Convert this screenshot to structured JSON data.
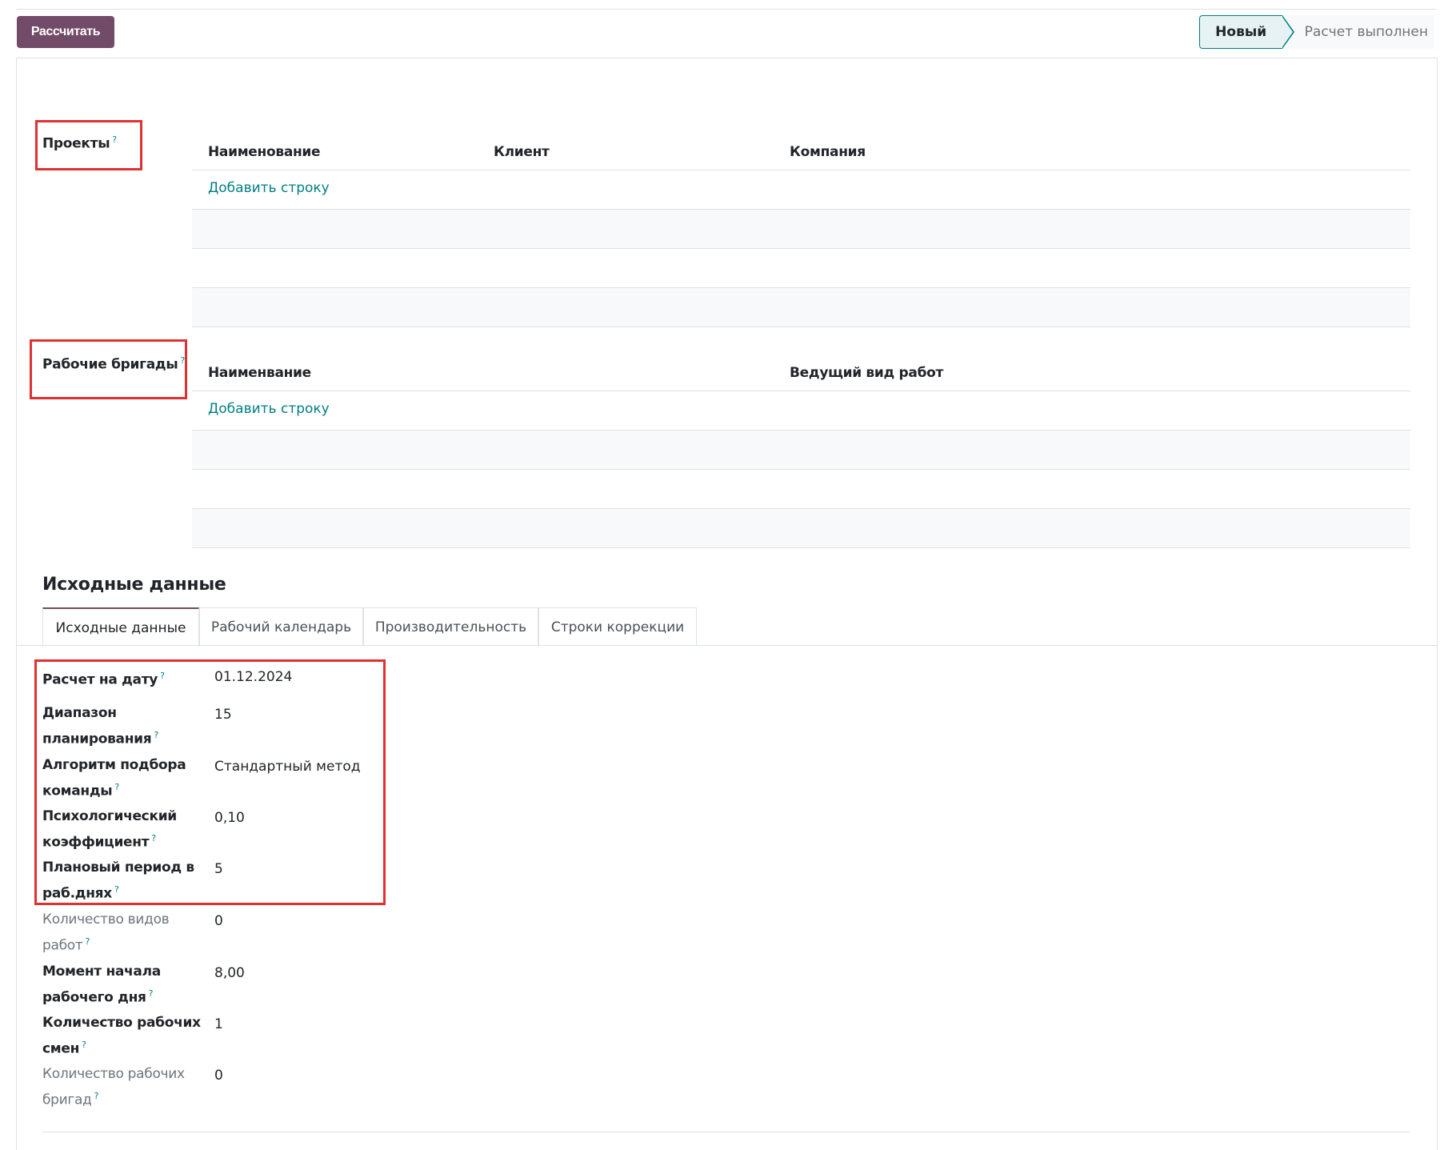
{
  "toolbar": {
    "calculate_label": "Рассчитать"
  },
  "status": {
    "current": "Новый",
    "next": "Расчет выполнен"
  },
  "help_mark": "?",
  "projects": {
    "label": "Проекты",
    "columns": [
      "Наименование",
      "Клиент",
      "Компания"
    ],
    "add_row": "Добавить строку"
  },
  "teams": {
    "label": "Рабочие бригады",
    "columns": [
      "Наименвание",
      "Ведущий вид работ"
    ],
    "add_row": "Добавить строку"
  },
  "section": {
    "title": "Исходные данные"
  },
  "tabs": [
    {
      "label": "Исходные данные",
      "active": true
    },
    {
      "label": "Рабочий календарь",
      "active": false
    },
    {
      "label": "Производительность",
      "active": false
    },
    {
      "label": "Строки коррекции",
      "active": false
    }
  ],
  "fields": [
    {
      "label": "Расчет на дату",
      "value": "01.12.2024",
      "muted": false
    },
    {
      "label": "Диапазон планирования",
      "value": "15",
      "muted": false
    },
    {
      "label": "Алгоритм подбора команды",
      "value": "Стандартный метод",
      "muted": false
    },
    {
      "label": "Психологический коэффициент",
      "value": "0,10",
      "muted": false
    },
    {
      "label": "Плановый период в раб.днях",
      "value": "5",
      "muted": false
    },
    {
      "label": "Количество видов работ",
      "value": "0",
      "muted": true
    },
    {
      "label": "Момент начала рабочего дня",
      "value": "8,00",
      "muted": false
    },
    {
      "label": "Количество рабочих смен",
      "value": "1",
      "muted": false
    },
    {
      "label": "Количество рабочих бригад",
      "value": "0",
      "muted": true
    }
  ],
  "colors": {
    "primary": "#714b67",
    "accent": "#017e84",
    "highlight_box": "#e03131"
  }
}
